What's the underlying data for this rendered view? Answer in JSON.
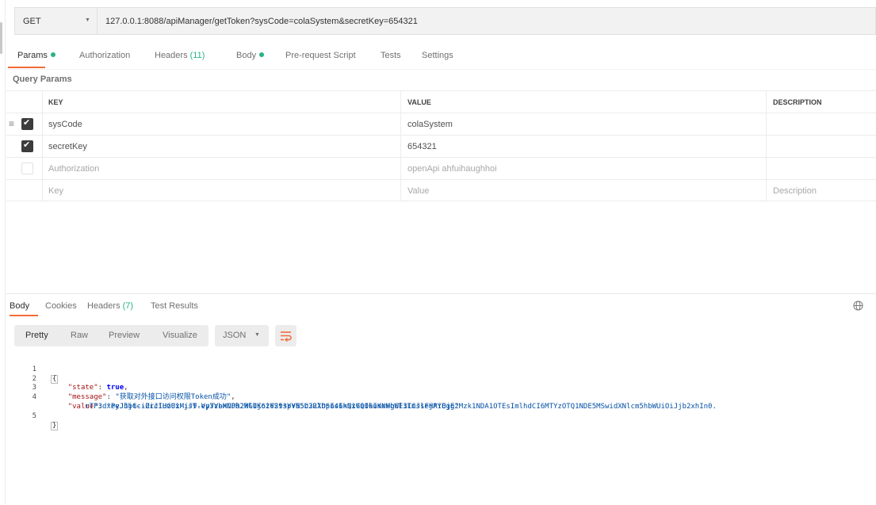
{
  "request": {
    "method": "GET",
    "url": "127.0.0.1:8088/apiManager/getToken?sysCode=colaSystem&secretKey=654321"
  },
  "request_tabs": [
    {
      "label": "Params",
      "active": true,
      "dot": true
    },
    {
      "label": "Authorization"
    },
    {
      "label": "Headers",
      "count": "(11)"
    },
    {
      "label": "Body",
      "dot": true
    },
    {
      "label": "Pre-request Script"
    },
    {
      "label": "Tests"
    },
    {
      "label": "Settings"
    }
  ],
  "query_params": {
    "title": "Query Params",
    "headers": {
      "key": "KEY",
      "value": "VALUE",
      "description": "DESCRIPTION"
    },
    "rows": [
      {
        "key": "sysCode",
        "value": "colaSystem",
        "checked": true
      },
      {
        "key": "secretKey",
        "value": "654321",
        "checked": true
      },
      {
        "key": "Authorization",
        "value": "openApi ahfuihaughhoi",
        "checked": false
      }
    ],
    "placeholder": {
      "key": "Key",
      "value": "Value",
      "description": "Description"
    }
  },
  "response_tabs": [
    {
      "label": "Body",
      "active": true
    },
    {
      "label": "Cookies"
    },
    {
      "label": "Headers",
      "count": "(7)"
    },
    {
      "label": "Test Results"
    }
  ],
  "response_toolbar": {
    "views": [
      "Pretty",
      "Raw",
      "Preview",
      "Visualize"
    ],
    "selected_view": "Pretty",
    "format": "JSON"
  },
  "response_body": {
    "line_numbers": [
      "1",
      "2",
      "3",
      "4",
      "",
      "5"
    ],
    "open_brace": "{",
    "close_brace": "}",
    "state_key": "\"state\"",
    "state_value": "true",
    "message_key": "\"message\"",
    "message_value": "\"获取对外接口访问权限Token成功\"",
    "value_key": "\"value\"",
    "value_part1": "\"eyJhbGciOiJIUzUxMiJ9.eyJzeXNDb2RlIjoiY29sYVN5c3RlbSIsInN1YiI6ImNvbGEiLCJleHAiOjE2Mzk1NDA1OTEsImlhdCI6MTYzOTQ1NDE5MSwidXNlcm5hbWUiOiJjb2xhIn0.",
    "value_part2": "rTP3dxPeJJjt--ZrciHG01-jsT-VpYVbHCPR2WGUK626St3pYB5D22XOpn46kQxGQ0kuKrMgWl3TmssFjPYEgg\""
  },
  "colors": {
    "accent": "#f26b3a",
    "dot": "#26b47f",
    "string": "#0451a5",
    "key": "#a31515"
  }
}
